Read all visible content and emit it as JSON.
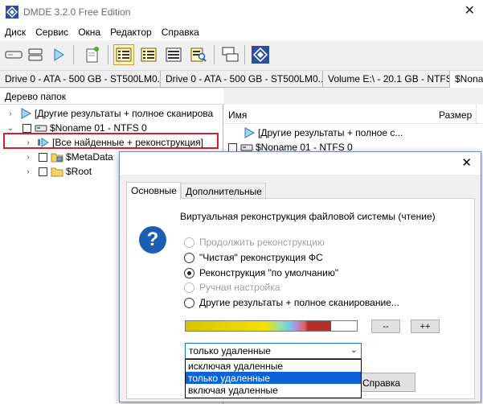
{
  "app": {
    "title": "DMDE 3.2.0 Free Edition",
    "close_glyph": "✕"
  },
  "menu": [
    "Диск",
    "Сервис",
    "Окна",
    "Редактор",
    "Справка"
  ],
  "tabs": [
    "Drive 0 - ATA - 500 GB - ST500LM0...",
    "Drive 0 - ATA - 500 GB - ST500LM0...",
    "Volume E:\\ - 20.1 GB - NTFS",
    "$Noname"
  ],
  "tree": {
    "header": "Дерево папок",
    "rows": [
      "[Другие результаты + полное сканирова",
      "$Noname 01 - NTFS 0",
      "[Все найденные + реконструкция]",
      "$MetaData",
      "$Root"
    ]
  },
  "list": {
    "col_name": "Имя",
    "col_size": "Размер",
    "rows": [
      "[Другие результаты + полное с...",
      "$Noname 01 - NTFS 0"
    ]
  },
  "dialog": {
    "close_glyph": "✕",
    "tabs": [
      "Основные",
      "Дополнительные"
    ],
    "help_glyph": "?",
    "heading": "Виртуальная реконструкция файловой системы (чтение)",
    "options": [
      {
        "label": "Продолжить реконструкцию",
        "enabled": false,
        "selected": false
      },
      {
        "label": "\"Чистая\" реконструкция ФС",
        "enabled": true,
        "selected": false
      },
      {
        "label": "Реконструкция \"по умолчанию\"",
        "enabled": true,
        "selected": true
      },
      {
        "label": "Ручная настройка",
        "enabled": false,
        "selected": false
      },
      {
        "label": "Другие результаты + полное сканирование...",
        "enabled": true,
        "selected": false
      }
    ],
    "progress_fraction": 0.85,
    "minus_label": "--",
    "plus_label": "++",
    "select_value": "только удаленные",
    "select_arrow": "⌄",
    "dropdown_options": [
      "исключая удаленные",
      "только удаленные",
      "включая удаленные"
    ],
    "dropdown_selected_index": 1,
    "help_button": "Справка"
  },
  "colors": {
    "accent": "#0a64d6",
    "highlight_border": "#d0202c",
    "help_icon": "#1a5fb4"
  }
}
